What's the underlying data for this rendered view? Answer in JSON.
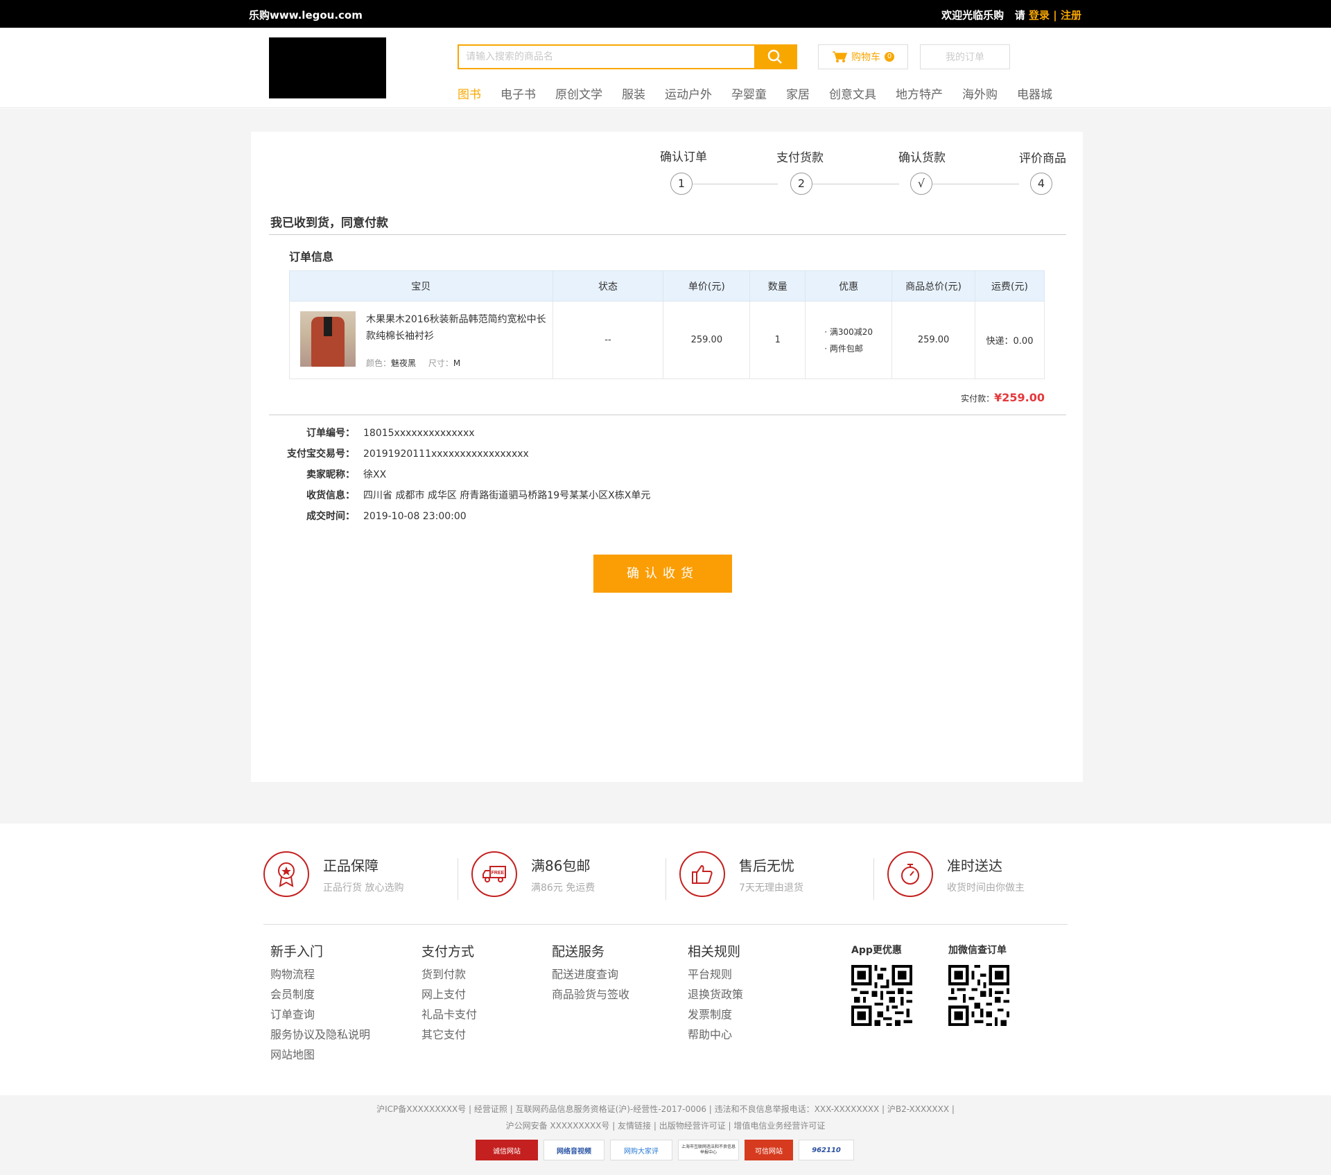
{
  "topbar": {
    "site": "乐购www.legou.com",
    "welcome": "欢迎光临乐购",
    "please": "请",
    "login": "登录",
    "sep": "|",
    "register": "注册"
  },
  "header": {
    "search_placeholder": "请输入搜索的商品名",
    "cart_label": "购物车",
    "cart_count": "0",
    "my_orders": "我的订单",
    "nav": [
      "图书",
      "电子书",
      "原创文学",
      "服装",
      "运动户外",
      "孕婴童",
      "家居",
      "创意文具",
      "地方特产",
      "海外购",
      "电器城"
    ]
  },
  "steps": {
    "labels": [
      "确认订单",
      "支付货款",
      "确认货款",
      "评价商品"
    ],
    "marks": [
      "1",
      "2",
      "√",
      "4"
    ]
  },
  "order": {
    "title": "我已收到货，同意付款",
    "subtitle": "订单信息",
    "columns": [
      "宝贝",
      "状态",
      "单价(元)",
      "数量",
      "优惠",
      "商品总价(元)",
      "运费(元)"
    ],
    "item": {
      "name": "木果果木2016秋装新品韩范简约宽松中长款纯棉长袖衬衫",
      "color_label": "颜色：",
      "color": "魅夜黑",
      "size_label": "尺寸：",
      "size": "M",
      "status": "--",
      "price": "259.00",
      "qty": "1",
      "promo1": "· 满300减20",
      "promo2": "· 两件包邮",
      "total": "259.00",
      "shipping": "快递：0.00"
    },
    "paid_label": "实付款：",
    "paid_value": "¥259.00",
    "info": [
      {
        "k": "订单编号：",
        "v": "18015xxxxxxxxxxxxxx"
      },
      {
        "k": "支付宝交易号：",
        "v": "20191920111xxxxxxxxxxxxxxxxx"
      },
      {
        "k": "卖家昵称：",
        "v": "徐XX"
      },
      {
        "k": "收货信息：",
        "v": "四川省  成都市  成华区  府青路街道驷马桥路19号某某小区X栋X单元"
      },
      {
        "k": "成交时间：",
        "v": "2019-10-08    23:00:00"
      }
    ],
    "confirm_button": "确认收货"
  },
  "features": [
    {
      "title": "正品保障",
      "sub": "正品行货  放心选购",
      "icon": "medal-icon"
    },
    {
      "title": "满86包邮",
      "sub": "满86元 免运费",
      "icon": "free-truck-icon"
    },
    {
      "title": "售后无忧",
      "sub": "7天无理由退货",
      "icon": "thumbs-up-icon"
    },
    {
      "title": "准时送达",
      "sub": "收货时间由你做主",
      "icon": "stopwatch-icon"
    }
  ],
  "footer_cols": [
    {
      "h": "新手入门",
      "links": [
        "购物流程",
        "会员制度",
        "订单查询",
        "服务协议及隐私说明",
        "网站地图"
      ]
    },
    {
      "h": "支付方式",
      "links": [
        "货到付款",
        "网上支付",
        "礼品卡支付",
        "其它支付"
      ]
    },
    {
      "h": "配送服务",
      "links": [
        "配送进度查询",
        "商品验货与签收"
      ]
    },
    {
      "h": "相关规则",
      "links": [
        "平台规则",
        "退换货政策",
        "发票制度",
        "帮助中心"
      ]
    }
  ],
  "qr": {
    "app": "App更优惠",
    "wechat": "加微信查订单"
  },
  "legal": {
    "line1": "沪ICP备XXXXXXXXX号 | 经营证照 | 互联网药品信息服务资格证(沪)-经营性-2017-0006 | 违法和不良信息举报电话：XXX-XXXXXXXX | 沪B2-XXXXXXX |",
    "line2": "沪公网安备 XXXXXXXXX号 | 友情链接 | 出版物经营许可证 | 增值电信业务经营许可证"
  },
  "badges": [
    "诚信网站",
    "网络音视频",
    "网购大家评",
    "上海市互联网违法和不良信息举报中心",
    "可信网站",
    "962110"
  ],
  "colors": {
    "accent": "#f8a700",
    "button": "#fb9e05",
    "price": "#e4393c",
    "feature_icon": "#c4201f"
  }
}
